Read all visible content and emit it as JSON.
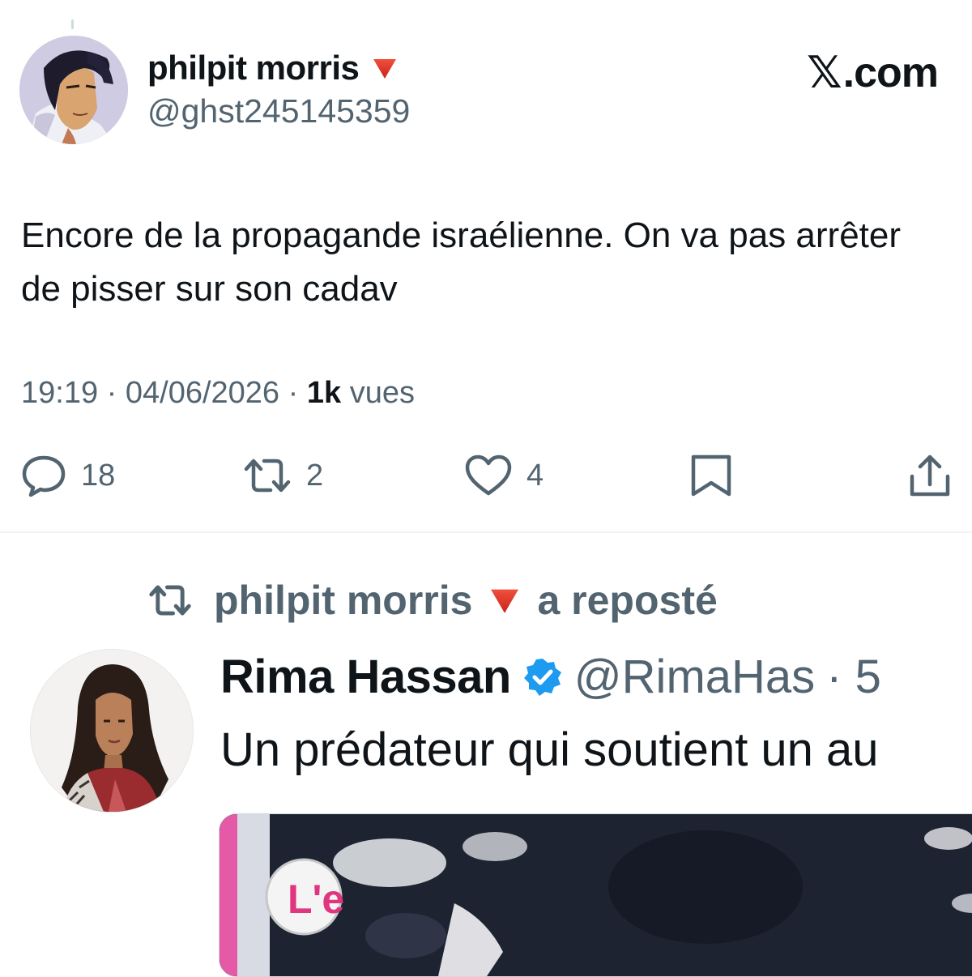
{
  "tweet": {
    "author_name": "philpit morris",
    "author_handle": "@ghst245145359",
    "brand": ".com",
    "text": "Encore de la propagande israélienne. On va pas arrêter de pisser sur son cadav",
    "time": "19:19",
    "date": "04/06/2026",
    "separator": "·",
    "views_count": "1k",
    "views_label": "vues",
    "actions": {
      "replies": "18",
      "reposts": "2",
      "likes": "4"
    }
  },
  "repost": {
    "reposter_name": "philpit morris",
    "reposted_label": "a reposté",
    "author_name": "Rima Hassan",
    "author_handle": "@RimaHas",
    "time_fragment": "· 5",
    "text": "Un prédateur qui soutient un au",
    "media_logo_text": "L'e"
  },
  "colors": {
    "text_primary": "#0f1419",
    "text_secondary": "#536471",
    "verified_blue": "#1d9bf0",
    "red_triangle": "#e0352a",
    "divider": "#eff3f4"
  },
  "icons": [
    "red-triangle-icon",
    "x-logo-icon",
    "reply-icon",
    "repost-icon",
    "like-icon",
    "bookmark-icon",
    "share-icon",
    "verified-badge-icon"
  ]
}
